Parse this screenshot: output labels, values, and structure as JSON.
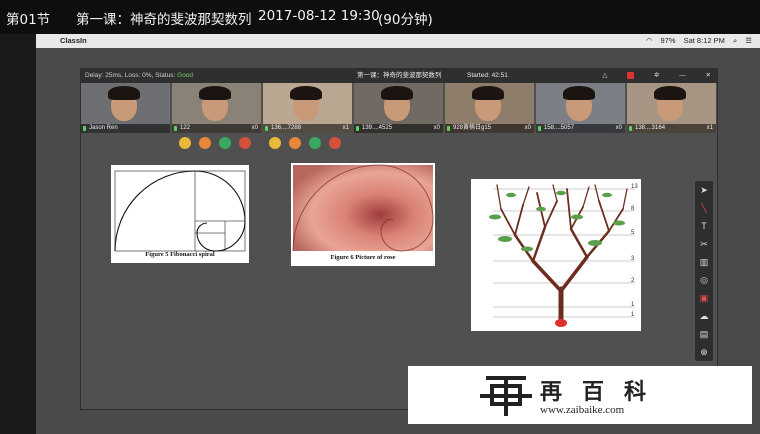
{
  "lesson_bar": {
    "section": "第01节",
    "lesson": "第一课：神奇的斐波那契数列",
    "datetime": "2017-08-12 19:30",
    "duration": "(90分钟)"
  },
  "mac_menubar": {
    "app_name": "ClassIn",
    "battery": "97%",
    "clock": "Sat 8:12 PM"
  },
  "classin": {
    "net_status_prefix": "Delay: 25ms, Loss: 0%, Status:",
    "net_status_value": "Good",
    "window_title": "第一课：神奇的斐波那契数列",
    "started": "Started: 42:51",
    "participants": [
      {
        "name": "Jason Ren",
        "score": ""
      },
      {
        "name": "122",
        "score": "x0"
      },
      {
        "name": "136....7288",
        "score": "x1"
      },
      {
        "name": "139....4525",
        "score": "x0"
      },
      {
        "name": "928黄楠日g15",
        "score": "x0"
      },
      {
        "name": "158....5057",
        "score": "x0"
      },
      {
        "name": "138....3164",
        "score": "x1"
      }
    ],
    "cards": {
      "spiral_caption": "Figure 5 Fibonacci spiral",
      "rose_caption": "Figure 6 Picture of rose",
      "tree_levels": [
        "13",
        "8",
        "5",
        "3",
        "2",
        "1",
        "1"
      ]
    }
  },
  "watermark": {
    "brand": "再百科",
    "url": "www.zaibaike.com"
  },
  "colors": {
    "good": "#6fcf5f",
    "award_gold": "#e8b93a",
    "award_orange": "#e8873a",
    "award_green": "#3aa860",
    "award_red": "#d4503a"
  },
  "icons": [
    "apple-icon",
    "pointer-icon",
    "pen-icon",
    "text-icon",
    "scissors-icon",
    "trash-icon",
    "eraser-icon",
    "cloud-icon",
    "toolbox-icon",
    "exit-icon"
  ]
}
